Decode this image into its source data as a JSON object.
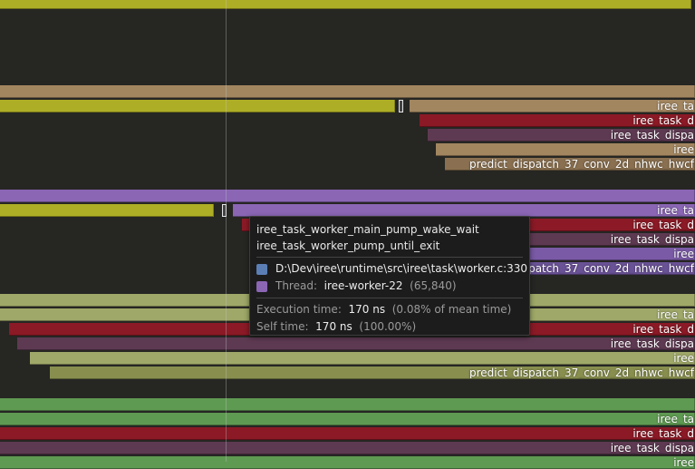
{
  "profiler": {
    "name_iree_ta": "iree_ta",
    "name_iree_task_d": "iree_task_d",
    "name_iree_task_dispa": "iree_task_dispa",
    "name_iree": "iree",
    "name_predict": "predict_dispatch_37_conv_2d_nhwc_hwcf",
    "name_predict_cut": "predict_dispatch_37_conv_2d_nhwc_hwcf"
  },
  "tooltip": {
    "zone_name": "iree_task_worker_main_pump_wake_wait",
    "parent_name": "iree_task_worker_pump_until_exit",
    "source_location": "D:\\Dev\\iree\\runtime\\src\\iree\\task\\worker.c:330",
    "thread_label": "Thread:",
    "thread_name": "iree-worker-22",
    "thread_id": "(65,840)",
    "exec_label": "Execution time:",
    "exec_value": "170 ns",
    "exec_note": "(0.08% of mean time)",
    "self_label": "Self time:",
    "self_value": "170 ns",
    "self_note": "(100.00%)",
    "source_color": "#5b7fb5",
    "thread_color": "#8a66b4"
  },
  "colors": {
    "background": "#262623",
    "olive_bright": "#b0b028",
    "tan": "#a28660",
    "crimson": "#8b1a26",
    "plum": "#5e3a52",
    "lavender": "#8a66b4",
    "sage": "#9fa868",
    "green": "#5f9a52"
  }
}
